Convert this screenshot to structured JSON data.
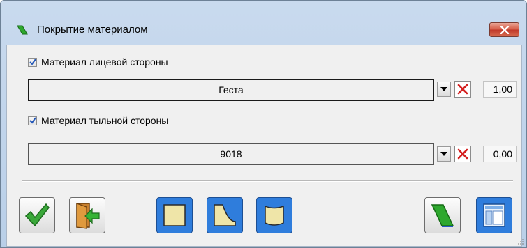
{
  "window": {
    "title": "Покрытие материалом",
    "close_icon": "close-icon"
  },
  "front": {
    "checkbox_label": "Материал лицевой стороны",
    "checked": true,
    "material": "Геста",
    "value": "1,00"
  },
  "back": {
    "checkbox_label": "Материал тыльной стороны",
    "checked": true,
    "material": "9018",
    "value": "0,00"
  },
  "toolbar": {
    "buttons": [
      {
        "name": "ok-button",
        "icon": "checkmark-icon"
      },
      {
        "name": "exit-button",
        "icon": "exit-door-icon"
      },
      {
        "name": "flat-panel-button",
        "icon": "flat-panel-icon"
      },
      {
        "name": "curved-profile-button",
        "icon": "curved-profile-icon"
      },
      {
        "name": "bent-panel-button",
        "icon": "bent-panel-icon"
      },
      {
        "name": "material-button",
        "icon": "material-swatch-icon"
      },
      {
        "name": "layout-button",
        "icon": "window-layout-icon"
      }
    ]
  },
  "colors": {
    "accent_blue": "#2f7ddc",
    "panel_fill": "#efe5a8",
    "material_green": "#2ea82e",
    "close_red": "#c0392a"
  }
}
